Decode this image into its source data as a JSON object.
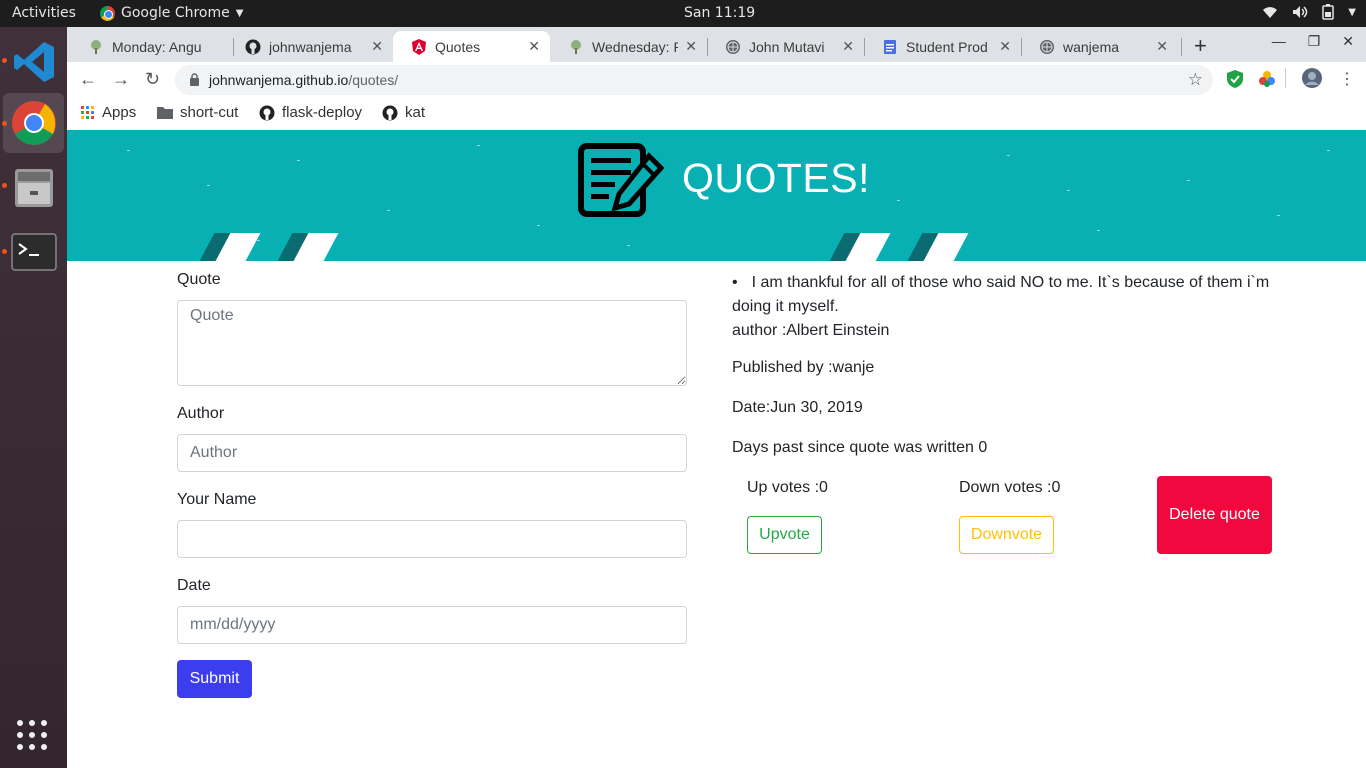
{
  "system": {
    "activities": "Activities",
    "app_name": "Google Chrome",
    "clock": "San 11:19"
  },
  "browser": {
    "tabs": [
      {
        "title": "Monday: Angu",
        "icon": "tree-favicon"
      },
      {
        "title": "johnwanjema",
        "icon": "github-favicon"
      },
      {
        "title": "Quotes",
        "icon": "angular-favicon",
        "active": true
      },
      {
        "title": "Wednesday: P",
        "icon": "tree-favicon"
      },
      {
        "title": "John Mutavi",
        "icon": "globe-favicon"
      },
      {
        "title": "Student Prod",
        "icon": "docs-favicon"
      },
      {
        "title": "wanjema",
        "icon": "globe-favicon"
      }
    ],
    "url_host": "johnwanjema.github.io",
    "url_path": "/quotes/",
    "bookmarks": [
      {
        "label": "Apps",
        "icon": "apps-grid-icon"
      },
      {
        "label": "short-cut",
        "icon": "folder-icon"
      },
      {
        "label": "flask-deploy",
        "icon": "github-icon"
      },
      {
        "label": "kat",
        "icon": "github-icon"
      }
    ]
  },
  "hero": {
    "title": "QUOTES!",
    "bg_color": "#08b0b3"
  },
  "form": {
    "quote_label": "Quote",
    "quote_placeholder": "Quote",
    "author_label": "Author",
    "author_placeholder": "Author",
    "name_label": "Your Name",
    "name_placeholder": "",
    "date_label": "Date",
    "date_placeholder": "mm/dd/yyyy",
    "submit_label": "Submit"
  },
  "quote": {
    "bullet": "•",
    "text": "I am thankful for all of those who said NO to me. It`s because of them i`m doing it myself.",
    "author_line": "author :Albert Einstein",
    "published_line": "Published by :wanje",
    "date_line": "Date:Jun 30, 2019",
    "days_line": "Days past since quote was written 0",
    "up_votes": "Up votes :0",
    "down_votes": "Down votes :0",
    "upvote_label": "Upvote",
    "downvote_label": "Downvote",
    "delete_label": "Delete quote"
  },
  "colors": {
    "submit": "#3d3df0",
    "upvote": "#28a745",
    "downvote": "#ffc107",
    "delete": "#f0083f"
  }
}
